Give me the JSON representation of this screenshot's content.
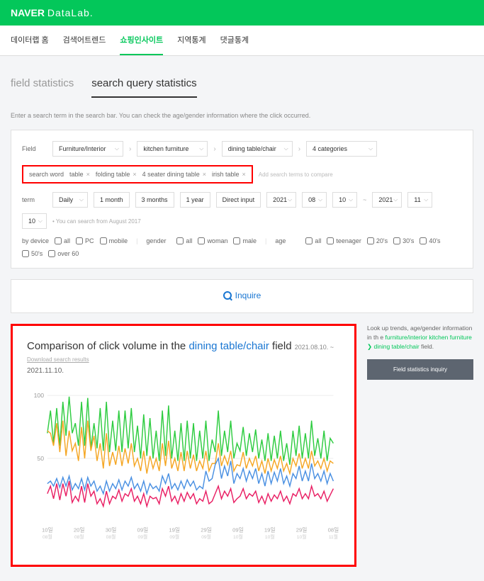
{
  "header": {
    "naver": "NAVER",
    "datalab": "DataLab."
  },
  "tabs": [
    "데이터랩 홈",
    "검색어트렌드",
    "쇼핑인사이트",
    "지역통계",
    "댓글통계"
  ],
  "active_tab": 2,
  "subtabs": [
    "field statistics",
    "search query statistics"
  ],
  "active_subtab": 1,
  "helper": "Enter a search term in the search bar. You can check the age/gender information where the click occurred.",
  "field": {
    "label": "Field",
    "selects": [
      "Furniture/Interior",
      "kitchen furniture",
      "dining table/chair",
      "4 categories"
    ]
  },
  "search_word": {
    "label": "search word",
    "tags": [
      "table",
      "folding table",
      "4 seater dining table",
      "irish table"
    ],
    "placeholder": "Add search terms to compare"
  },
  "term": {
    "label": "term",
    "daily": "Daily",
    "periods": [
      "1 month",
      "3 months",
      "1 year",
      "Direct input"
    ],
    "from": {
      "year": "2021",
      "month": "08",
      "day": "10"
    },
    "to": {
      "year": "2021",
      "month": "11",
      "day": "10"
    },
    "hint": "• You can search from August 2017"
  },
  "device": {
    "label": "by device",
    "opts": [
      "all",
      "PC",
      "mobile"
    ]
  },
  "gender": {
    "label": "gender",
    "opts": [
      "all",
      "woman",
      "male"
    ]
  },
  "age": {
    "label": "age",
    "opts": [
      "all",
      "teenager",
      "20's",
      "30's",
      "40's",
      "50's",
      "over 60"
    ]
  },
  "inquire": "Inquire",
  "chart": {
    "title_pre": "Comparison of click volume in the ",
    "title_highlight": "dining table/chair",
    "title_post": " field",
    "date_range": "2021.08.10. ~",
    "download": "Download search results",
    "sub_date": "2021.11.10."
  },
  "sidebar": {
    "text_pre": "Look up trends, age/gender information in th e ",
    "text_green": "furniture/interior kitchen furniture ❯ dining table/chair",
    "text_post": " field.",
    "button": "Field statistics inquiry"
  },
  "chart_data": {
    "type": "line",
    "ylim": [
      0,
      100
    ],
    "yticks": [
      50,
      100
    ],
    "x_labels": [
      {
        "top": "10일",
        "bot": "08월"
      },
      {
        "top": "20일",
        "bot": "08월"
      },
      {
        "top": "30일",
        "bot": "08월"
      },
      {
        "top": "09일",
        "bot": "09월"
      },
      {
        "top": "19일",
        "bot": "09월"
      },
      {
        "top": "29일",
        "bot": "09월"
      },
      {
        "top": "09일",
        "bot": "10월"
      },
      {
        "top": "19일",
        "bot": "10월"
      },
      {
        "top": "29일",
        "bot": "10월"
      },
      {
        "top": "08일",
        "bot": "11월"
      }
    ],
    "series": [
      {
        "name": "table",
        "color": "#2ecc40",
        "values": [
          70,
          88,
          62,
          90,
          60,
          95,
          68,
          99,
          70,
          78,
          60,
          95,
          60,
          98,
          58,
          78,
          58,
          90,
          56,
          95,
          55,
          80,
          56,
          88,
          55,
          88,
          58,
          90,
          55,
          76,
          50,
          85,
          52,
          82,
          50,
          72,
          48,
          88,
          52,
          92,
          50,
          72,
          48,
          78,
          48,
          80,
          50,
          78,
          48,
          72,
          50,
          80,
          48,
          65,
          55,
          88,
          52,
          72,
          55,
          80,
          50,
          62,
          56,
          75,
          52,
          70,
          55,
          73,
          50,
          65,
          48,
          70,
          48,
          68,
          50,
          72,
          48,
          62,
          45,
          72,
          52,
          76,
          50,
          70,
          50,
          80,
          52,
          66,
          50,
          72,
          48,
          66,
          62
        ]
      },
      {
        "name": "folding table",
        "color": "#f5a623",
        "values": [
          72,
          70,
          60,
          78,
          55,
          80,
          52,
          72,
          56,
          62,
          48,
          75,
          50,
          80,
          56,
          68,
          48,
          62,
          42,
          70,
          44,
          55,
          45,
          60,
          44,
          58,
          46,
          62,
          44,
          50,
          40,
          56,
          38,
          52,
          42,
          50,
          40,
          62,
          44,
          64,
          42,
          50,
          40,
          55,
          40,
          56,
          42,
          53,
          40,
          48,
          42,
          56,
          40,
          46,
          46,
          62,
          44,
          52,
          45,
          56,
          40,
          45,
          44,
          55,
          42,
          50,
          44,
          52,
          40,
          48,
          38,
          50,
          40,
          49,
          42,
          52,
          40,
          46,
          38,
          50,
          44,
          54,
          42,
          50,
          42,
          56,
          44,
          48,
          42,
          50,
          40,
          48,
          46
        ]
      },
      {
        "name": "4 seater dining table",
        "color": "#4a90e2",
        "values": [
          30,
          32,
          28,
          34,
          27,
          35,
          28,
          36,
          25,
          30,
          26,
          34,
          25,
          35,
          28,
          32,
          24,
          28,
          22,
          32,
          24,
          30,
          26,
          33,
          25,
          32,
          28,
          35,
          26,
          30,
          24,
          32,
          22,
          30,
          26,
          28,
          24,
          36,
          30,
          38,
          26,
          30,
          25,
          32,
          26,
          33,
          28,
          32,
          25,
          28,
          26,
          40,
          32,
          34,
          45,
          50,
          34,
          44,
          36,
          48,
          30,
          38,
          34,
          42,
          32,
          40,
          34,
          42,
          30,
          38,
          28,
          40,
          30,
          39,
          32,
          42,
          30,
          36,
          28,
          38,
          34,
          44,
          32,
          40,
          32,
          46,
          34,
          38,
          32,
          40,
          30,
          38,
          32
        ]
      },
      {
        "name": "irish table",
        "color": "#e91e63",
        "values": [
          22,
          28,
          18,
          30,
          17,
          30,
          20,
          32,
          15,
          20,
          16,
          28,
          15,
          30,
          20,
          24,
          14,
          18,
          12,
          24,
          14,
          20,
          18,
          25,
          16,
          22,
          20,
          26,
          16,
          20,
          14,
          22,
          12,
          20,
          18,
          19,
          14,
          26,
          20,
          28,
          16,
          20,
          14,
          22,
          16,
          23,
          18,
          22,
          14,
          18,
          16,
          24,
          14,
          16,
          22,
          28,
          18,
          24,
          20,
          26,
          15,
          18,
          20,
          26,
          18,
          22,
          20,
          24,
          15,
          20,
          14,
          22,
          16,
          21,
          18,
          24,
          16,
          20,
          14,
          22,
          20,
          26,
          18,
          22,
          18,
          28,
          20,
          22,
          18,
          24,
          16,
          21,
          26
        ]
      }
    ]
  }
}
